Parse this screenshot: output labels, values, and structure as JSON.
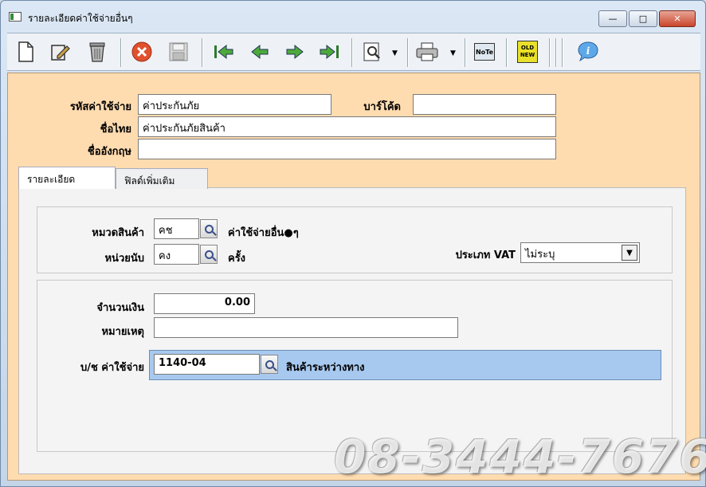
{
  "window": {
    "title": "รายละเอียดค่าใช้จ่ายอื่นๆ",
    "min_label": "—",
    "max_label": "□",
    "close_label": "✕"
  },
  "toolbar": {
    "icons": [
      "new-doc-icon",
      "edit-icon",
      "delete-icon",
      "cancel-icon",
      "save-icon",
      "first-record-icon",
      "prev-record-icon",
      "next-record-icon",
      "last-record-icon",
      "search-icon",
      "print-icon",
      "note-icon",
      "old-new-icon",
      "info-icon"
    ],
    "note_label": "NoTe",
    "oldnew_label": "OLD NEW"
  },
  "header": {
    "code_label": "รหัสค่าใช้จ่าย",
    "code_value": "ค่าประกันภัย",
    "barcode_label": "บาร์โค้ด",
    "barcode_value": "",
    "thai_name_label": "ชื่อไทย",
    "thai_name_value": "ค่าประกันภัยสินค้า",
    "eng_name_label": "ชื่ออังกฤษ",
    "eng_name_value": ""
  },
  "tabs": [
    {
      "label": "รายละเอียด",
      "active": true
    },
    {
      "label": "ฟิลด์เพิ่มเติม",
      "active": false
    }
  ],
  "details": {
    "category_label": "หมวดสินค้า",
    "category_code": "คช",
    "category_name": "ค่าใช้จ่ายอื่น●ๆ",
    "unit_label": "หน่วยนับ",
    "unit_code": "คง",
    "unit_name": "ครั้ง",
    "vat_label": "ประเภท VAT",
    "vat_value": "ไม่ระบุ",
    "amount_label": "จำนวนเงิน",
    "amount_value": "0.00",
    "note_label": "หมายเหตุ",
    "note_value": "",
    "account_label": "บ/ช ค่าใช้จ่าย",
    "account_code": "1140-04",
    "account_name": "สินค้าระหว่างทาง"
  },
  "watermark": "08-3444-7676"
}
